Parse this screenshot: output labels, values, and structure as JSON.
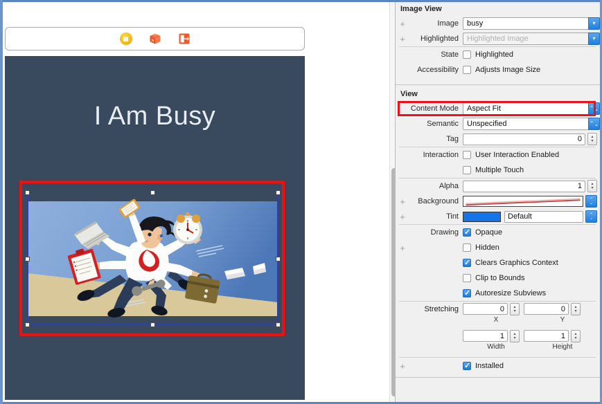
{
  "canvas": {
    "scene_dock": {
      "icons": [
        {
          "name": "view-controller-icon",
          "label": "View Controller"
        },
        {
          "name": "first-responder-icon",
          "label": "First Responder"
        },
        {
          "name": "exit-icon",
          "label": "Exit"
        }
      ]
    },
    "device": {
      "title": "I Am Busy",
      "background_color": "#3a4a5e",
      "image_view": {
        "selected": true,
        "image_name": "busy",
        "illustration_alt": "Busy businessman running with many arms holding laptop, clipboard, smartphone, alarm clock, wrench and briefcase",
        "sky_color": "#7ba2d6",
        "ground_color": "#d9c89a"
      }
    }
  },
  "inspector": {
    "sections": [
      {
        "title": "Image View",
        "rows": [
          {
            "label": "Image",
            "value": "busy",
            "placeholder": ""
          },
          {
            "label": "Highlighted",
            "value": "",
            "placeholder": "Highlighted Image"
          },
          {
            "label": "State",
            "checkbox": "Highlighted",
            "checked": false
          },
          {
            "label": "Accessibility",
            "checkbox": "Adjusts Image Size",
            "checked": false
          }
        ]
      },
      {
        "title": "View",
        "content_mode": {
          "label": "Content Mode",
          "value": "Aspect Fit",
          "highlighted": true
        },
        "semantic": {
          "label": "Semantic",
          "value": "Unspecified"
        },
        "tag": {
          "label": "Tag",
          "value": "0"
        },
        "interaction": {
          "label": "Interaction",
          "items": [
            {
              "text": "User Interaction Enabled",
              "checked": false
            },
            {
              "text": "Multiple Touch",
              "checked": false
            }
          ]
        },
        "alpha": {
          "label": "Alpha",
          "value": "1"
        },
        "background": {
          "label": "Background",
          "value": "",
          "swatch": "clear"
        },
        "tint": {
          "label": "Tint",
          "value": "Default",
          "swatch_color": "#1474e8"
        },
        "drawing": {
          "label": "Drawing",
          "items": [
            {
              "text": "Opaque",
              "checked": true
            },
            {
              "text": "Hidden",
              "checked": false
            },
            {
              "text": "Clears Graphics Context",
              "checked": true
            },
            {
              "text": "Clip to Bounds",
              "checked": false
            },
            {
              "text": "Autoresize Subviews",
              "checked": true
            }
          ]
        },
        "stretching": {
          "label": "Stretching",
          "x": {
            "value": "0",
            "caption": "X"
          },
          "y": {
            "value": "0",
            "caption": "Y"
          },
          "width": {
            "value": "1",
            "caption": "Width"
          },
          "height": {
            "value": "1",
            "caption": "Height"
          }
        },
        "installed": {
          "text": "Installed",
          "checked": true
        }
      }
    ]
  },
  "colors": {
    "highlight_red": "#ee1111",
    "selection_blue": "#2b3fb5",
    "accent_blue": "#1f7fe0",
    "device_bg": "#3a4a5e"
  }
}
